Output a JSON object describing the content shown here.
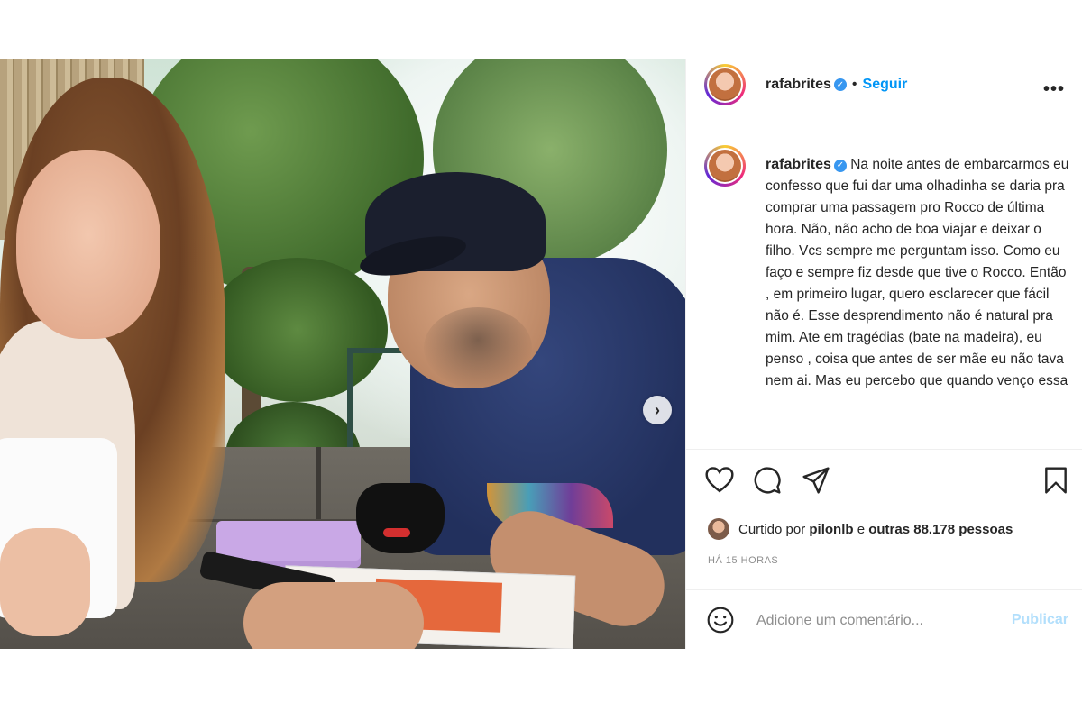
{
  "post": {
    "username": "rafabrites",
    "verified_icon": "verified-badge-icon",
    "separator": "•",
    "follow_label": "Seguir",
    "more_label": "•••",
    "caption": "Na noite antes de embarcarmos eu confesso que fui dar uma olhadinha se daria pra comprar uma passagem pro Rocco de última hora. Não, não acho de boa viajar e deixar o filho. Vcs sempre me perguntam isso. Como eu faço e sempre fiz desde que tive o Rocco. Então , em primeiro lugar, quero esclarecer que fácil não é. Esse desprendimento não é natural pra mim. Ate em tragédias (bate na madeira), eu penso , coisa que antes de ser mãe eu não tava nem ai. Mas eu percebo que quando venço essa",
    "likes": {
      "prefix": "Curtido por",
      "liker": "pilonlb",
      "connector": "e",
      "others": "outras 88.178 pessoas"
    },
    "timestamp": "HÁ 15 HORAS",
    "comment": {
      "placeholder": "Adicione um comentário...",
      "value": "",
      "publish_label": "Publicar"
    },
    "carousel": {
      "total": 2,
      "current": 1,
      "next_icon": "›"
    }
  },
  "colors": {
    "accent": "#0095f6",
    "verified": "#3897f0",
    "publish_disabled": "#b2dffc",
    "muted": "#8e8e8e"
  }
}
